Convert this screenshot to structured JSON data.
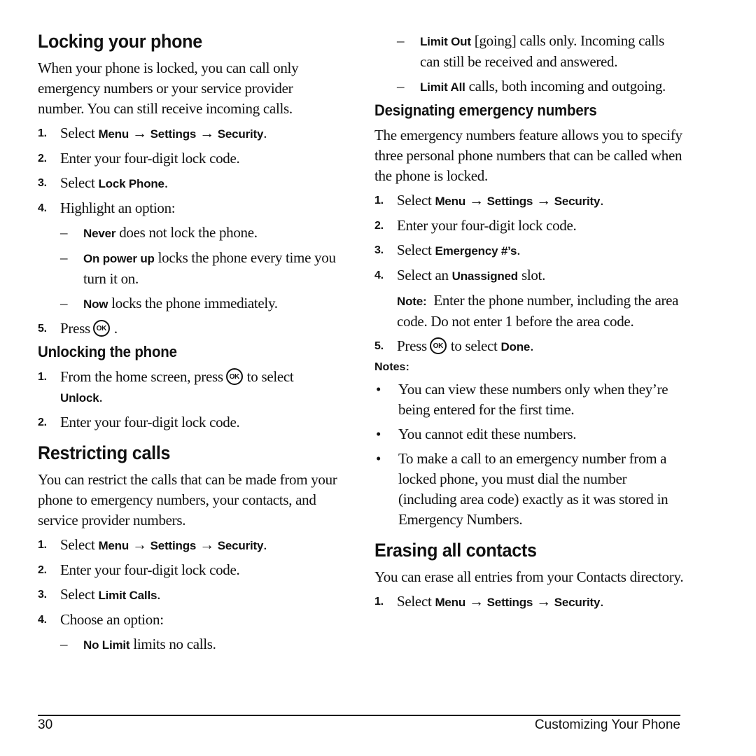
{
  "left": {
    "locking": {
      "title": "Locking your phone",
      "intro": "When your phone is locked, you can call only emergency numbers or your service provider number. You can still receive incoming calls.",
      "steps": [
        {
          "num": "1.",
          "pre": "Select ",
          "menu": "Menu",
          "arrow1": " → ",
          "settings": "Settings",
          "arrow2": " → ",
          "security": "Security",
          "post": "."
        },
        {
          "num": "2.",
          "text": "Enter your four-digit lock code."
        },
        {
          "num": "3.",
          "pre": "Select ",
          "bold": "Lock Phone",
          "post": "."
        },
        {
          "num": "4.",
          "text": "Highlight an option:"
        },
        {
          "num": "5.",
          "pre": "Press",
          "icon": "OK",
          "post": "."
        }
      ],
      "options": [
        {
          "dash": "–",
          "bold": "Never",
          "text": " does not lock the phone."
        },
        {
          "dash": "–",
          "bold": "On power up",
          "text": " locks the phone every time you turn it on."
        },
        {
          "dash": "–",
          "bold": "Now",
          "text": " locks the phone immediately."
        }
      ]
    },
    "unlocking": {
      "title": "Unlocking the phone",
      "steps": [
        {
          "num": "1.",
          "pre": "From the home screen, press",
          "icon": "OK",
          "mid": "to select ",
          "bold": "Unlock",
          "post": "."
        },
        {
          "num": "2.",
          "text": "Enter your four-digit lock code."
        }
      ]
    },
    "restricting": {
      "title": "Restricting calls",
      "intro": "You can restrict the calls that can be made from your phone to emergency numbers, your contacts, and service provider numbers.",
      "steps": [
        {
          "num": "1.",
          "pre": "Select ",
          "menu": "Menu",
          "arrow1": " → ",
          "settings": "Settings",
          "arrow2": " → ",
          "security": "Security",
          "post": "."
        },
        {
          "num": "2.",
          "text": "Enter your four-digit lock code."
        },
        {
          "num": "3.",
          "pre": "Select ",
          "bold": "Limit Calls",
          "post": "."
        },
        {
          "num": "4.",
          "text": "Choose an option:"
        }
      ],
      "options": [
        {
          "dash": "–",
          "bold": "No Limit",
          "text": " limits no calls."
        }
      ]
    }
  },
  "right": {
    "restricting_cont": {
      "options": [
        {
          "dash": "–",
          "bold": "Limit Out",
          "text": " [going] calls only. Incoming calls can still be received and answered."
        },
        {
          "dash": "–",
          "bold": "Limit All",
          "text": " calls, both incoming and outgoing."
        }
      ]
    },
    "emergency": {
      "title": "Designating emergency numbers",
      "intro": "The emergency numbers feature allows you to specify three personal phone numbers that can be called when the phone is locked.",
      "steps": [
        {
          "num": "1.",
          "pre": "Select ",
          "menu": "Menu",
          "arrow1": " → ",
          "settings": "Settings",
          "arrow2": " → ",
          "security": "Security",
          "post": "."
        },
        {
          "num": "2.",
          "text": "Enter your four-digit lock code."
        },
        {
          "num": "3.",
          "pre": "Select ",
          "bold": "Emergency #’s",
          "post": "."
        },
        {
          "num": "4.",
          "pre": "Select an ",
          "bold": "Unassigned",
          "post": " slot."
        },
        {
          "num": "5.",
          "pre": "Press",
          "icon": "OK",
          "mid": "to select ",
          "bold": "Done",
          "post": "."
        }
      ],
      "note_label": "Note:",
      "note_text": "  Enter the phone number, including the area code. Do not enter 1 before the area code.",
      "notes_label": "Notes:",
      "bullets": [
        "You can view these numbers only when they’re being entered for the first time.",
        "You cannot edit these numbers.",
        "To make a call to an emergency number from a locked phone, you must dial the number (including area code) exactly as it was stored in Emergency Numbers."
      ],
      "bullet_glyph": "•"
    },
    "erasing": {
      "title": "Erasing all contacts",
      "intro": "You can erase all entries from your Contacts directory.",
      "steps": [
        {
          "num": "1.",
          "pre": "Select ",
          "menu": "Menu",
          "arrow1": " → ",
          "settings": "Settings",
          "arrow2": " → ",
          "security": "Security",
          "post": "."
        }
      ]
    }
  },
  "footer": {
    "page_number": "30",
    "section_title": "Customizing Your Phone"
  }
}
